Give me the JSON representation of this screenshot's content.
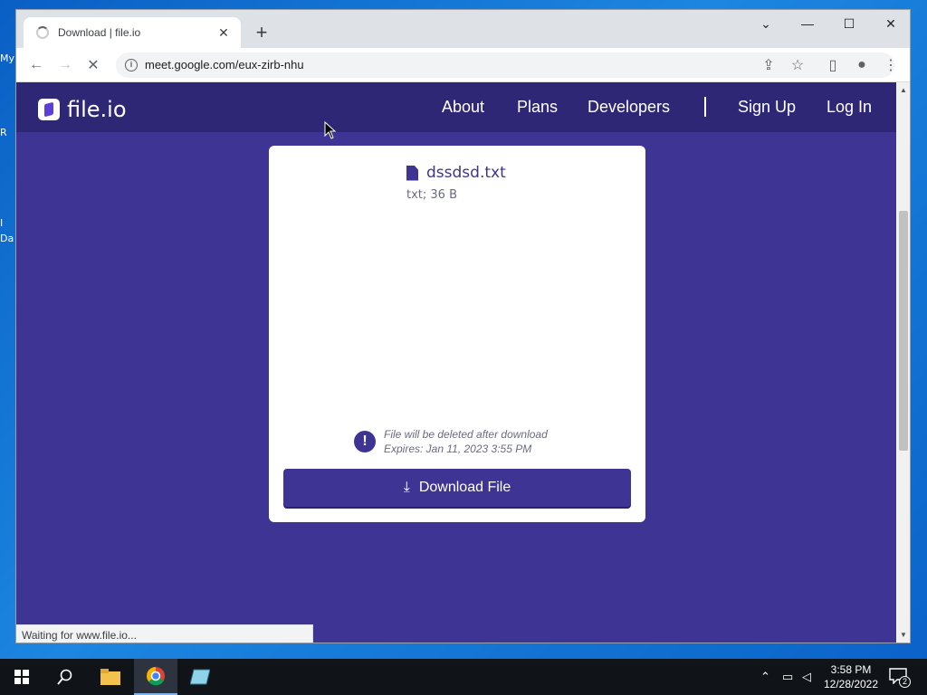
{
  "desktop": {
    "labels": [
      "My",
      "R",
      "I",
      "Da"
    ]
  },
  "browser": {
    "tab_title": "Download | file.io",
    "url": "meet.google.com/eux-zirb-nhu",
    "status_text": "Waiting for www.file.io..."
  },
  "site": {
    "logo_text": "file.io",
    "nav": {
      "about": "About",
      "plans": "Plans",
      "developers": "Developers",
      "signup": "Sign Up",
      "login": "Log In"
    },
    "file": {
      "name": "dssdsd.txt",
      "meta": "txt; 36 B"
    },
    "warning": {
      "line1": "File will be deleted after download",
      "line2": "Expires: Jan 11, 2023 3:55 PM"
    },
    "download_label": "Download File"
  },
  "taskbar": {
    "time": "3:58 PM",
    "date": "12/28/2022",
    "notification_count": "2"
  },
  "colors": {
    "page_bg": "#3d3494",
    "navbar_bg": "#2d2776",
    "button_bg": "#3d3494"
  }
}
